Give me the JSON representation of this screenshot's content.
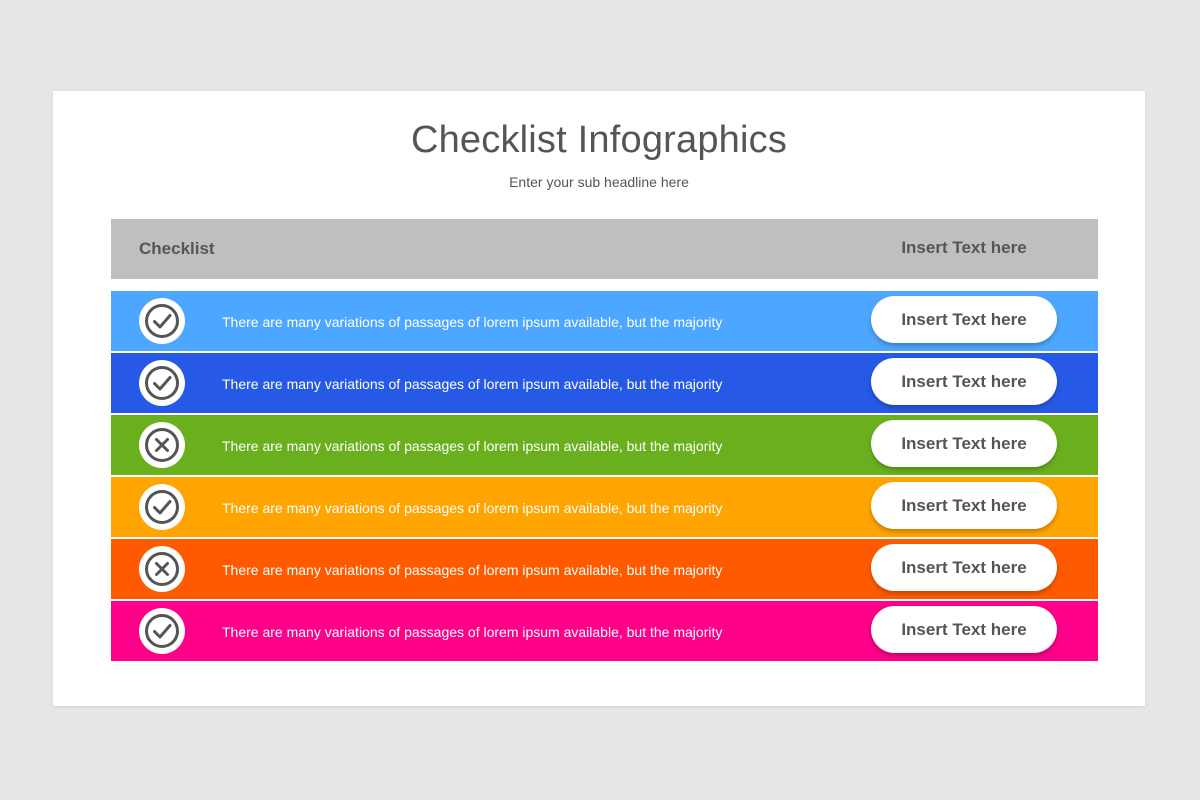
{
  "title": "Checklist Infographics",
  "subtitle": "Enter your sub headline here",
  "table": {
    "header": {
      "left": "Checklist",
      "right": "Insert Text here"
    },
    "rows": [
      {
        "status": "check",
        "icon": "check-circle-icon",
        "color": "#4da6ff",
        "text": "There are many variations of passages of lorem ipsum available, but the majority",
        "button": "Insert Text here"
      },
      {
        "status": "check",
        "icon": "check-circle-icon",
        "color": "#2659e6",
        "text": "There are many variations of passages of lorem ipsum available, but the majority",
        "button": "Insert Text here"
      },
      {
        "status": "cross",
        "icon": "x-circle-icon",
        "color": "#6ab01e",
        "text": "There are many variations of passages of lorem ipsum available, but the majority",
        "button": "Insert Text here"
      },
      {
        "status": "check",
        "icon": "check-circle-icon",
        "color": "#ffa400",
        "text": "There are many variations of passages of lorem ipsum available, but the majority",
        "button": "Insert Text here"
      },
      {
        "status": "cross",
        "icon": "x-circle-icon",
        "color": "#ff5a00",
        "text": "There are many variations of passages of lorem ipsum available, but the majority",
        "button": "Insert Text here"
      },
      {
        "status": "check",
        "icon": "check-circle-icon",
        "color": "#ff0088",
        "text": "There are many variations of passages of lorem ipsum available, but the majority",
        "button": "Insert Text here"
      }
    ]
  }
}
